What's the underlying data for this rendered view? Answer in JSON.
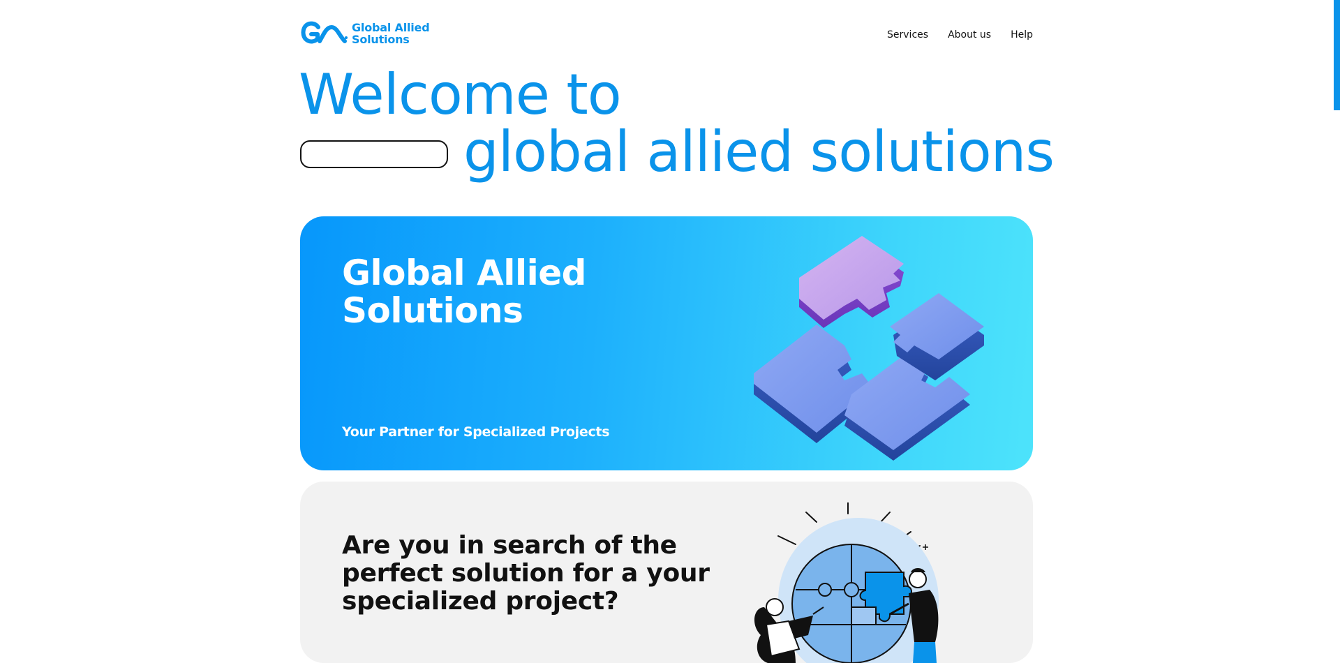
{
  "header": {
    "logo": {
      "icon": "ga-monogram-icon",
      "line1": "Global Allied",
      "line2": "Solutions"
    },
    "nav": [
      {
        "label": "Services"
      },
      {
        "label": "About us"
      },
      {
        "label": "Help"
      }
    ]
  },
  "hero": {
    "line1": "Welcome to",
    "line2": "global allied solutions"
  },
  "banner": {
    "title_line1": "Global Allied",
    "title_line2": "Solutions",
    "tagline": "Your Partner for Specialized Projects",
    "image": "3d-puzzle-pieces-illustration"
  },
  "intro": {
    "question": "Are you in search of the perfect solution for a your specialized project?",
    "image": "people-assembling-puzzle-globe-illustration"
  },
  "colors": {
    "brand_blue": "#0a93ea",
    "banner_gradient_start": "#0797fb",
    "banner_gradient_end": "#4de3fb",
    "gray_card": "#f2f2f2"
  }
}
